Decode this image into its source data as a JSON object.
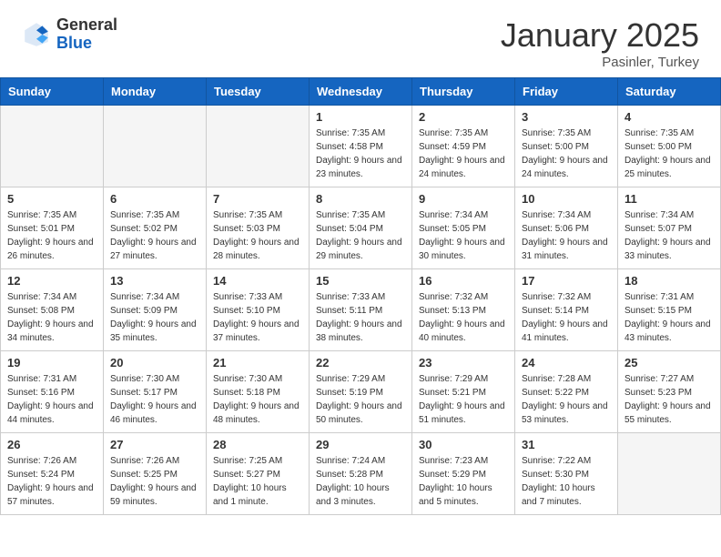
{
  "header": {
    "logo_general": "General",
    "logo_blue": "Blue",
    "month_title": "January 2025",
    "location": "Pasinler, Turkey"
  },
  "weekdays": [
    "Sunday",
    "Monday",
    "Tuesday",
    "Wednesday",
    "Thursday",
    "Friday",
    "Saturday"
  ],
  "weeks": [
    [
      {
        "day": "",
        "info": ""
      },
      {
        "day": "",
        "info": ""
      },
      {
        "day": "",
        "info": ""
      },
      {
        "day": "1",
        "info": "Sunrise: 7:35 AM\nSunset: 4:58 PM\nDaylight: 9 hours and 23 minutes."
      },
      {
        "day": "2",
        "info": "Sunrise: 7:35 AM\nSunset: 4:59 PM\nDaylight: 9 hours and 24 minutes."
      },
      {
        "day": "3",
        "info": "Sunrise: 7:35 AM\nSunset: 5:00 PM\nDaylight: 9 hours and 24 minutes."
      },
      {
        "day": "4",
        "info": "Sunrise: 7:35 AM\nSunset: 5:00 PM\nDaylight: 9 hours and 25 minutes."
      }
    ],
    [
      {
        "day": "5",
        "info": "Sunrise: 7:35 AM\nSunset: 5:01 PM\nDaylight: 9 hours and 26 minutes."
      },
      {
        "day": "6",
        "info": "Sunrise: 7:35 AM\nSunset: 5:02 PM\nDaylight: 9 hours and 27 minutes."
      },
      {
        "day": "7",
        "info": "Sunrise: 7:35 AM\nSunset: 5:03 PM\nDaylight: 9 hours and 28 minutes."
      },
      {
        "day": "8",
        "info": "Sunrise: 7:35 AM\nSunset: 5:04 PM\nDaylight: 9 hours and 29 minutes."
      },
      {
        "day": "9",
        "info": "Sunrise: 7:34 AM\nSunset: 5:05 PM\nDaylight: 9 hours and 30 minutes."
      },
      {
        "day": "10",
        "info": "Sunrise: 7:34 AM\nSunset: 5:06 PM\nDaylight: 9 hours and 31 minutes."
      },
      {
        "day": "11",
        "info": "Sunrise: 7:34 AM\nSunset: 5:07 PM\nDaylight: 9 hours and 33 minutes."
      }
    ],
    [
      {
        "day": "12",
        "info": "Sunrise: 7:34 AM\nSunset: 5:08 PM\nDaylight: 9 hours and 34 minutes."
      },
      {
        "day": "13",
        "info": "Sunrise: 7:34 AM\nSunset: 5:09 PM\nDaylight: 9 hours and 35 minutes."
      },
      {
        "day": "14",
        "info": "Sunrise: 7:33 AM\nSunset: 5:10 PM\nDaylight: 9 hours and 37 minutes."
      },
      {
        "day": "15",
        "info": "Sunrise: 7:33 AM\nSunset: 5:11 PM\nDaylight: 9 hours and 38 minutes."
      },
      {
        "day": "16",
        "info": "Sunrise: 7:32 AM\nSunset: 5:13 PM\nDaylight: 9 hours and 40 minutes."
      },
      {
        "day": "17",
        "info": "Sunrise: 7:32 AM\nSunset: 5:14 PM\nDaylight: 9 hours and 41 minutes."
      },
      {
        "day": "18",
        "info": "Sunrise: 7:31 AM\nSunset: 5:15 PM\nDaylight: 9 hours and 43 minutes."
      }
    ],
    [
      {
        "day": "19",
        "info": "Sunrise: 7:31 AM\nSunset: 5:16 PM\nDaylight: 9 hours and 44 minutes."
      },
      {
        "day": "20",
        "info": "Sunrise: 7:30 AM\nSunset: 5:17 PM\nDaylight: 9 hours and 46 minutes."
      },
      {
        "day": "21",
        "info": "Sunrise: 7:30 AM\nSunset: 5:18 PM\nDaylight: 9 hours and 48 minutes."
      },
      {
        "day": "22",
        "info": "Sunrise: 7:29 AM\nSunset: 5:19 PM\nDaylight: 9 hours and 50 minutes."
      },
      {
        "day": "23",
        "info": "Sunrise: 7:29 AM\nSunset: 5:21 PM\nDaylight: 9 hours and 51 minutes."
      },
      {
        "day": "24",
        "info": "Sunrise: 7:28 AM\nSunset: 5:22 PM\nDaylight: 9 hours and 53 minutes."
      },
      {
        "day": "25",
        "info": "Sunrise: 7:27 AM\nSunset: 5:23 PM\nDaylight: 9 hours and 55 minutes."
      }
    ],
    [
      {
        "day": "26",
        "info": "Sunrise: 7:26 AM\nSunset: 5:24 PM\nDaylight: 9 hours and 57 minutes."
      },
      {
        "day": "27",
        "info": "Sunrise: 7:26 AM\nSunset: 5:25 PM\nDaylight: 9 hours and 59 minutes."
      },
      {
        "day": "28",
        "info": "Sunrise: 7:25 AM\nSunset: 5:27 PM\nDaylight: 10 hours and 1 minute."
      },
      {
        "day": "29",
        "info": "Sunrise: 7:24 AM\nSunset: 5:28 PM\nDaylight: 10 hours and 3 minutes."
      },
      {
        "day": "30",
        "info": "Sunrise: 7:23 AM\nSunset: 5:29 PM\nDaylight: 10 hours and 5 minutes."
      },
      {
        "day": "31",
        "info": "Sunrise: 7:22 AM\nSunset: 5:30 PM\nDaylight: 10 hours and 7 minutes."
      },
      {
        "day": "",
        "info": ""
      }
    ]
  ]
}
